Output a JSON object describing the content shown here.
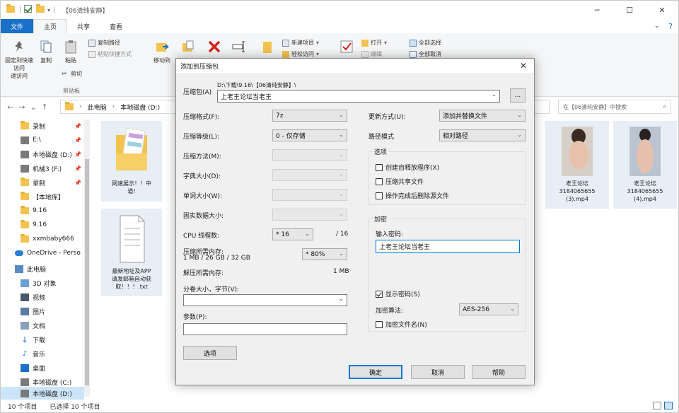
{
  "window": {
    "title": "【06清纯安静】",
    "controls": [
      "─",
      "☐",
      "✕"
    ]
  },
  "ribbon_tabs": [
    "文件",
    "主页",
    "共享",
    "查看"
  ],
  "ribbon": {
    "pin_quick_access": "固定到快速访问",
    "pin_quick_access_l2": "速访问",
    "copy": "复制",
    "paste": "粘贴",
    "copy_path": "复制路径",
    "paste_shortcut": "粘贴快捷方式",
    "cut": "剪切",
    "clipboard_group": "剪贴板",
    "move_to": "移动到",
    "new_item": "新建项目",
    "easy_access": "轻松访问",
    "open": "打开",
    "edit": "编辑",
    "select_all": "全部选择",
    "select_none": "全部取消"
  },
  "address": {
    "crumbs": [
      "此电脑",
      "本地磁盘 (D:)"
    ],
    "search_placeholder": "在【06清纯安静】中搜索"
  },
  "nav": {
    "items": [
      {
        "label": "录制",
        "pinned": true
      },
      {
        "label": "E:\\",
        "pinned": true
      },
      {
        "label": "本地磁盘 (D:)",
        "pinned": true
      },
      {
        "label": "机械3 (F:)",
        "pinned": true
      },
      {
        "label": "录制",
        "pinned": true
      },
      {
        "label": "【本地库】",
        "pinned": false
      },
      {
        "label": "9.16",
        "pinned": false
      },
      {
        "label": "9.16",
        "pinned": false
      },
      {
        "label": "xxmbaby666",
        "pinned": false
      },
      {
        "label": "OneDrive - Perso",
        "pinned": false
      },
      {
        "label": "此电脑",
        "pinned": false
      },
      {
        "label": "3D 对象",
        "pinned": false
      },
      {
        "label": "视频",
        "pinned": false
      },
      {
        "label": "图片",
        "pinned": false
      },
      {
        "label": "文档",
        "pinned": false
      },
      {
        "label": "下载",
        "pinned": false
      },
      {
        "label": "音乐",
        "pinned": false
      },
      {
        "label": "桌面",
        "pinned": false
      },
      {
        "label": "本地磁盘 (C:)",
        "pinned": false
      },
      {
        "label": "本地磁盘 (D:)",
        "pinned": false
      }
    ]
  },
  "files": [
    {
      "name": "网速展示！！中\n道!"
    },
    {
      "name": "最新地址及APP\n请发邮箱自动获\n取！！！.txt"
    },
    {
      "name": "老王论坛\n3184065655\n(3).mp4"
    },
    {
      "name": "老王论坛\n3184065655\n(4).mp4"
    }
  ],
  "status": {
    "count": "10 个项目",
    "selected": "已选择 10 个项目"
  },
  "dialog": {
    "title": "添加到压缩包",
    "close": "✕",
    "archive_label": "压缩包(A)",
    "archive_path": "D:\\下载\\9.16\\【06清纯安静】\\",
    "archive_name": "上老王论坛当老王",
    "browse": "...",
    "format_label": "压缩格式(F):",
    "format_value": "7z",
    "level_label": "压缩等级(L):",
    "level_value": "0 - 仅存储",
    "method_label": "压缩方法(M):",
    "dict_label": "字典大小(D):",
    "word_label": "单词大小(W):",
    "solid_label": "固实数据大小:",
    "cpu_label": "CPU 线程数:",
    "cpu_value": "* 16",
    "cpu_total": "/ 16",
    "mem_label": "压缩所需内存:",
    "mem_sub": "1 MB / 26 GB / 32 GB",
    "mem_pct": "* 80%",
    "dmem_label": "解压所需内存:",
    "dmem_value": "1 MB",
    "split_label": "分卷大小，字节(V):",
    "params_label": "参数(P):",
    "options_btn": "选项",
    "update_label": "更新方式(U):",
    "update_value": "添加并替换文件",
    "path_label": "路径模式",
    "path_value": "相对路径",
    "options_group": "选项",
    "opt_sfx": "创建自释放程序(X)",
    "opt_shared": "压缩共享文件",
    "opt_delete": "操作完成后删除源文件",
    "enc_group": "加密",
    "pwd_label": "输入密码:",
    "pwd_value": "上老王论坛当老王",
    "show_pwd": "显示密码(S)",
    "enc_method_label": "加密算法:",
    "enc_method_value": "AES-256",
    "enc_names": "加密文件名(N)",
    "ok": "确定",
    "cancel": "取消",
    "help": "帮助"
  }
}
